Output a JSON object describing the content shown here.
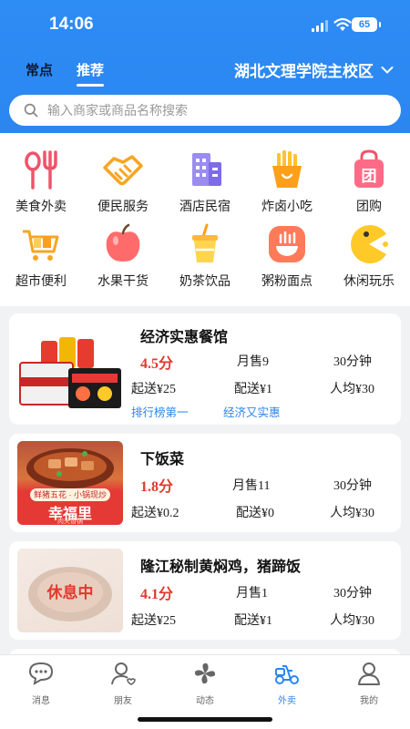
{
  "status": {
    "time": "14:06",
    "battery": "65"
  },
  "header": {
    "tabs": [
      {
        "label": "常点"
      },
      {
        "label": "推荐"
      }
    ],
    "campus": "湖北文理学院主校区"
  },
  "search": {
    "placeholder": "输入商家或商品名称搜索"
  },
  "categories": [
    {
      "label": "美食外卖",
      "icon": "fork-spoon-icon"
    },
    {
      "label": "便民服务",
      "icon": "handshake-icon"
    },
    {
      "label": "酒店民宿",
      "icon": "hotel-building-icon"
    },
    {
      "label": "炸卤小吃",
      "icon": "fries-icon"
    },
    {
      "label": "团购",
      "icon": "group-buy-bag-icon",
      "badge": "团"
    },
    {
      "label": "超市便利",
      "icon": "shopping-cart-icon"
    },
    {
      "label": "水果干货",
      "icon": "apple-icon"
    },
    {
      "label": "奶茶饮品",
      "icon": "milk-tea-icon"
    },
    {
      "label": "粥粉面点",
      "icon": "noodle-bowl-icon"
    },
    {
      "label": "休闲玩乐",
      "icon": "pacman-icon"
    }
  ],
  "stores": [
    {
      "name": "经济实惠餐馆",
      "score": "4.5分",
      "sales": "月售9",
      "time": "30分钟",
      "min_order": "起送¥25",
      "delivery": "配送¥1",
      "per_capita": "人均¥30",
      "tags": [
        "排行榜第一",
        "经济又实惠"
      ],
      "resting": false
    },
    {
      "name": "下饭菜",
      "score": "1.8分",
      "sales": "月售11",
      "time": "30分钟",
      "min_order": "起送¥0.2",
      "delivery": "配送¥0",
      "per_capita": "人均¥30",
      "tags": [],
      "resting": false,
      "thumb_banner": {
        "top": "鲜猪五花 · 小锅现炒",
        "title": "幸福里",
        "sub": "肉夹香锅"
      }
    },
    {
      "name": "隆江秘制黄焖鸡，猪蹄饭",
      "score": "4.1分",
      "sales": "月售1",
      "time": "30分钟",
      "min_order": "起送¥25",
      "delivery": "配送¥1",
      "per_capita": "人均¥30",
      "tags": [],
      "resting": true,
      "rest_label": "休息中"
    }
  ],
  "nav": [
    {
      "label": "消息",
      "icon": "message-bubble-icon"
    },
    {
      "label": "朋友",
      "icon": "friends-icon"
    },
    {
      "label": "动态",
      "icon": "pinwheel-icon"
    },
    {
      "label": "外卖",
      "icon": "delivery-scooter-icon",
      "active": true
    },
    {
      "label": "我的",
      "icon": "profile-icon"
    }
  ],
  "colors": {
    "brand": "#2b86f0",
    "price": "#e03a2e",
    "background": "#f1f2f4"
  }
}
